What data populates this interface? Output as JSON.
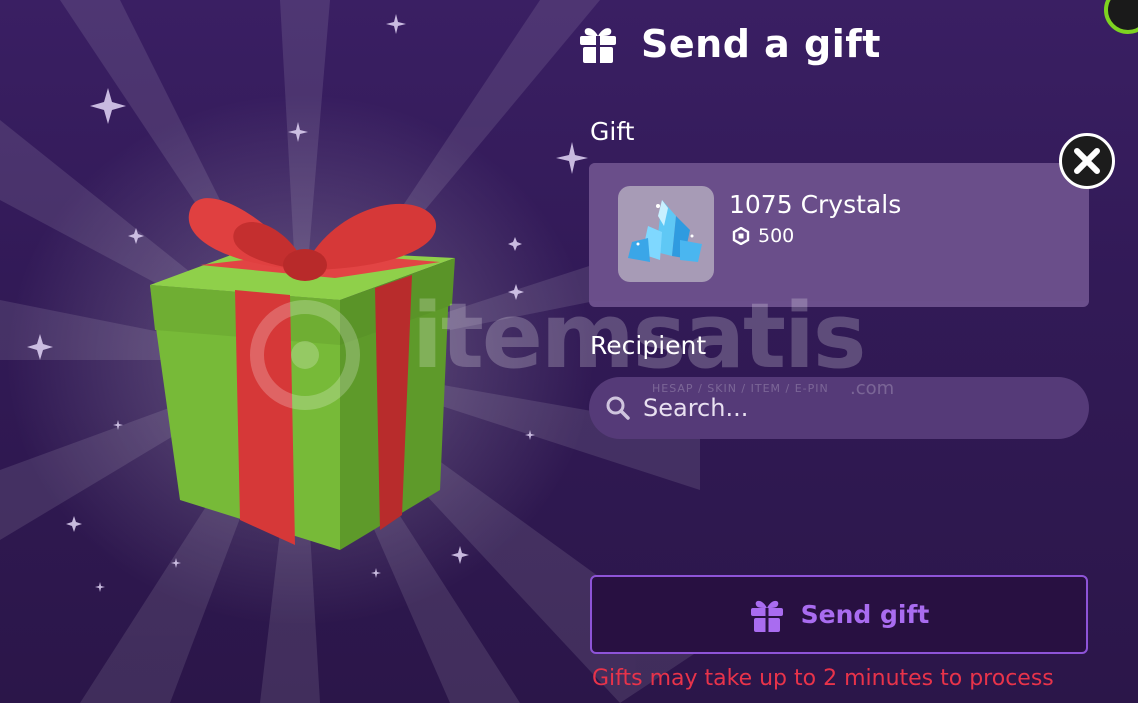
{
  "header": {
    "title": "Send a gift",
    "icon": "gift-icon"
  },
  "gift_section": {
    "label": "Gift",
    "item": {
      "name": "1075 Crystals",
      "price": "500",
      "price_icon": "robux-icon",
      "thumbnail_icon": "crystals-icon"
    }
  },
  "recipient_section": {
    "label": "Recipient",
    "search_placeholder": "Search..."
  },
  "send_button": {
    "label": "Send gift",
    "icon": "gift-icon",
    "accent_color": "#a96cf0"
  },
  "notice": "Gifts may take up to 2 minutes to process",
  "watermark": {
    "text": "itemsatis",
    "subtitle": "HESAP / SKIN / ITEM / E-PIN",
    "domain": ".com"
  },
  "colors": {
    "background": "#2a1547",
    "card": "#6a4e8a",
    "notice": "#e8334a",
    "gift_box": "#7bbf3c",
    "ribbon": "#d93a3a"
  }
}
